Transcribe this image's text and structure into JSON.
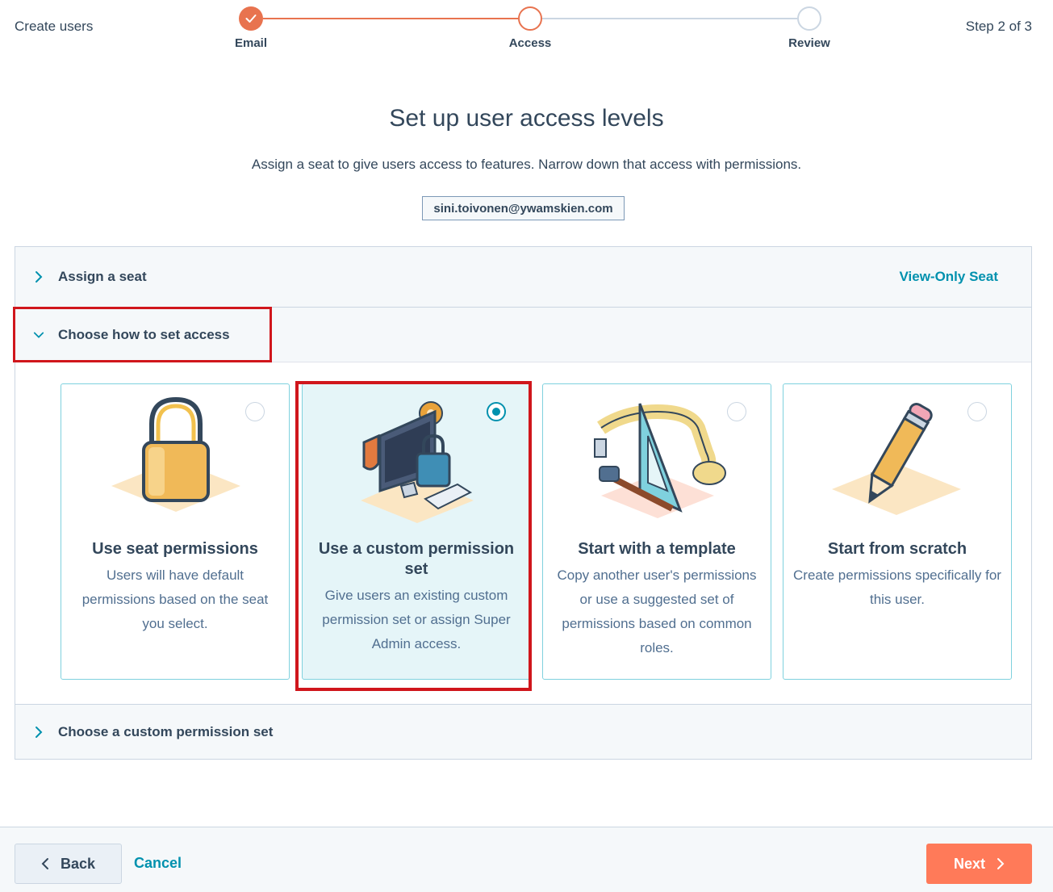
{
  "header": {
    "title": "Create users",
    "step_counter": "Step 2 of 3",
    "steps": [
      {
        "label": "Email",
        "state": "done"
      },
      {
        "label": "Access",
        "state": "active"
      },
      {
        "label": "Review",
        "state": "todo"
      }
    ]
  },
  "main": {
    "title": "Set up user access levels",
    "subtitle": "Assign a seat to give users access to features. Narrow down that access with permissions.",
    "email": "sini.toivonen@ywamskien.com"
  },
  "accordion": {
    "assign_seat": {
      "label": "Assign a seat",
      "value": "View-Only Seat"
    },
    "choose_access": {
      "label": "Choose how to set access"
    },
    "custom_set": {
      "label": "Choose a custom permission set"
    }
  },
  "cards": [
    {
      "title": "Use seat permissions",
      "description": "Users will have default permissions based on the seat you select.",
      "selected": false,
      "icon": "padlock-icon"
    },
    {
      "title": "Use a custom permission set",
      "description": "Give users an existing custom permission set or assign Super Admin access.",
      "selected": true,
      "icon": "computer-lock-icon"
    },
    {
      "title": "Start with a template",
      "description": "Copy another user's permissions or use a suggested set of permissions based on common roles.",
      "selected": false,
      "icon": "ruler-tools-icon"
    },
    {
      "title": "Start from scratch",
      "description": "Create permissions specifically for this user.",
      "selected": false,
      "icon": "pencil-icon"
    }
  ],
  "footer": {
    "back_label": "Back",
    "cancel_label": "Cancel",
    "next_label": "Next"
  },
  "colors": {
    "accent_orange": "#ff7a59",
    "link_teal": "#0091ae",
    "text_dark": "#33475b",
    "highlight_red": "#d0161c"
  }
}
